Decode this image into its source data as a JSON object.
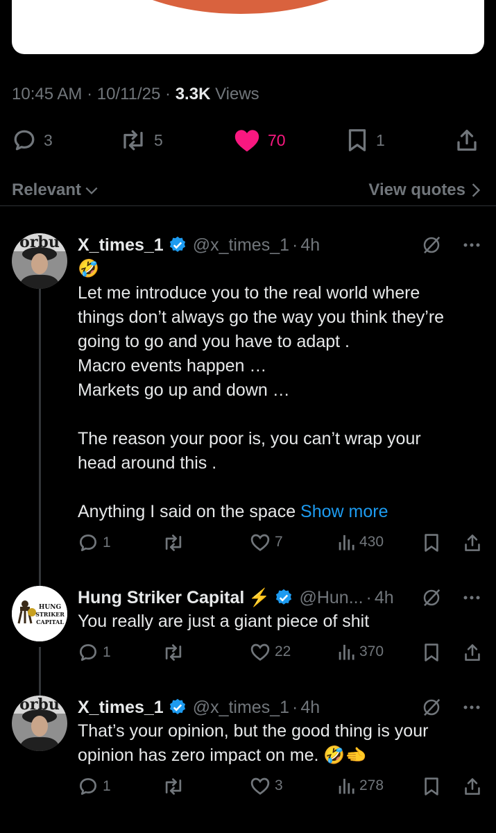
{
  "tweet": {
    "time": "10:45 AM",
    "date": "10/11/25",
    "views_count": "3.3K",
    "views_label": "Views",
    "replies": "3",
    "reposts": "5",
    "likes": "70",
    "bookmarks": "1"
  },
  "filter": {
    "sort_label": "Relevant",
    "quotes_label": "View quotes"
  },
  "replies": [
    {
      "name": "X_times_1",
      "handle": "@x_times_1",
      "time": "4h",
      "emoji_line": "🤣",
      "lines": [
        "Let me introduce you to the real world where",
        "things don’t always go the way you think they’re",
        "going to go and you have to adapt .",
        "Macro events happen …",
        "Markets go up and down …",
        "",
        "The reason your poor is, you can’t wrap your",
        "head around this .",
        ""
      ],
      "last_line": "Anything I said on the space ",
      "show_more": "Show more",
      "avatar_text": "orbu",
      "stats": {
        "replies": "1",
        "reposts": "",
        "likes": "7",
        "views": "430"
      }
    },
    {
      "name": "Hung Striker Capital",
      "name_emoji": "⚡",
      "handle": "@Hun...",
      "time": "4h",
      "lines": [
        "You really are just a giant piece of shit"
      ],
      "avatar_text": [
        "HUNG",
        "STRIKER",
        "CAPITAL"
      ],
      "stats": {
        "replies": "1",
        "reposts": "",
        "likes": "22",
        "views": "370"
      }
    },
    {
      "name": "X_times_1",
      "handle": "@x_times_1",
      "time": "4h",
      "lines": [
        "That’s your opinion, but the good thing is your",
        "opinion has zero impact on me. 🤣🫲"
      ],
      "avatar_text": "orbu",
      "stats": {
        "replies": "1",
        "reposts": "",
        "likes": "3",
        "views": "278"
      }
    }
  ],
  "colors": {
    "background": "#000000",
    "text": "#e7e9ea",
    "muted": "#71767b",
    "like_active": "#f91880",
    "link": "#1d9bf0",
    "verified": "#1d9bf0"
  }
}
